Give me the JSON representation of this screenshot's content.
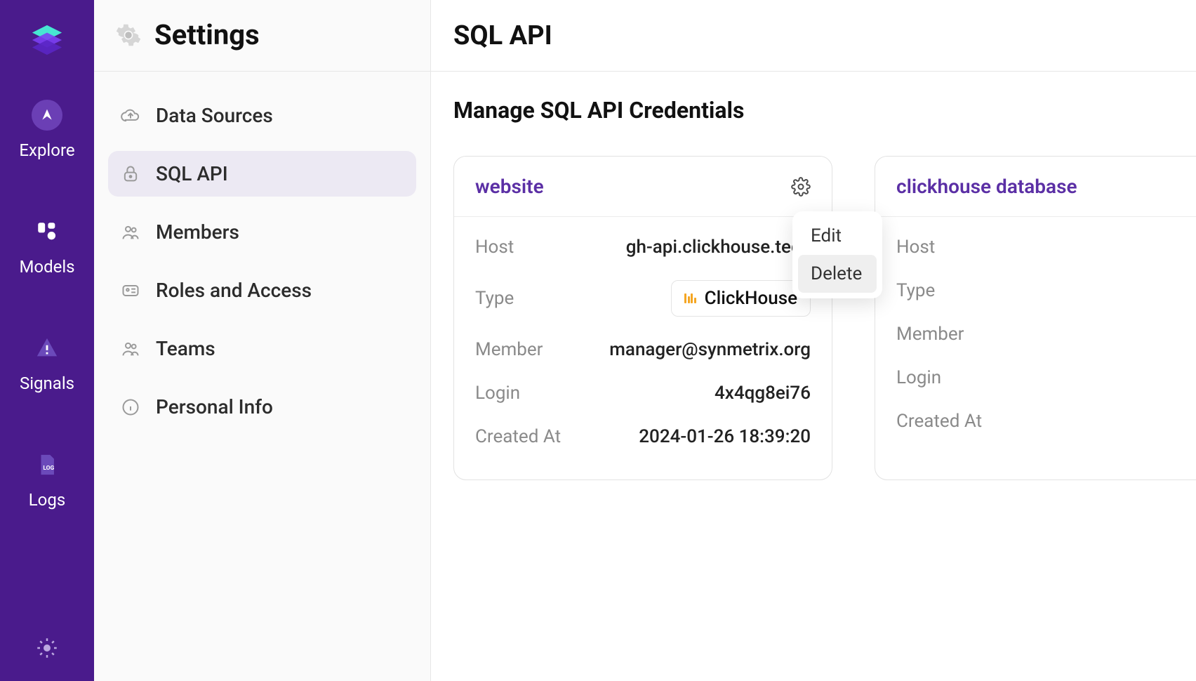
{
  "nav": {
    "items": [
      {
        "label": "Explore"
      },
      {
        "label": "Models"
      },
      {
        "label": "Signals"
      },
      {
        "label": "Logs"
      }
    ]
  },
  "sidebar": {
    "title": "Settings",
    "items": [
      {
        "label": "Data Sources"
      },
      {
        "label": "SQL API"
      },
      {
        "label": "Members"
      },
      {
        "label": "Roles and Access"
      },
      {
        "label": "Teams"
      },
      {
        "label": "Personal Info"
      }
    ]
  },
  "main": {
    "title": "SQL API",
    "subtitle": "Manage SQL API Credentials"
  },
  "labels": {
    "host": "Host",
    "type": "Type",
    "member": "Member",
    "login": "Login",
    "created_at": "Created At"
  },
  "cards": [
    {
      "title": "website",
      "host": "gh-api.clickhouse.tech",
      "type": "ClickHouse",
      "member": "manager@synmetrix.org",
      "login": "4x4qg8ei76",
      "created_at": "2024-01-26 18:39:20"
    },
    {
      "title": "clickhouse database",
      "host": "",
      "type": "",
      "member": "",
      "login": "",
      "created_at": ""
    }
  ],
  "menu": {
    "edit": "Edit",
    "delete": "Delete"
  }
}
